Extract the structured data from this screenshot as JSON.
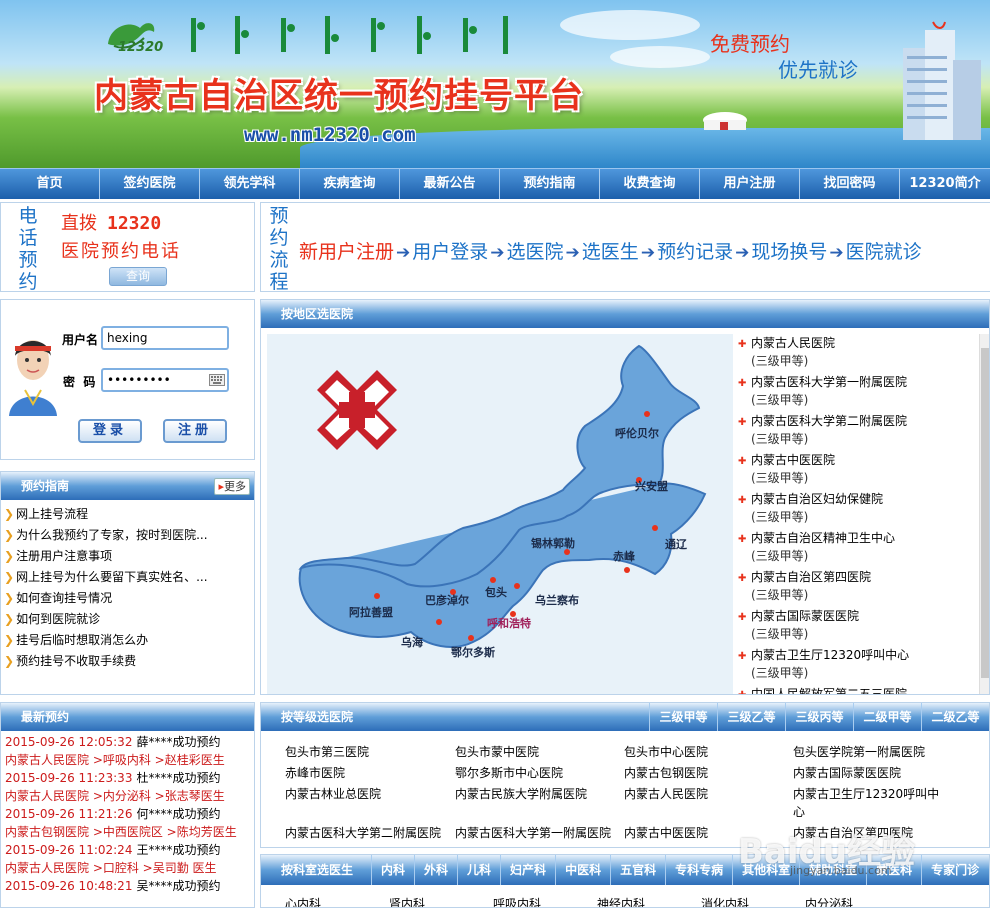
{
  "header": {
    "logo_text": "12320",
    "title": "内蒙古自治区统一预约挂号平台",
    "url": "www.nm12320.com",
    "slogan1": "免费预约",
    "slogan2": "优先就诊"
  },
  "nav": [
    "首页",
    "签约医院",
    "领先学科",
    "疾病查询",
    "最新公告",
    "预约指南",
    "收费查询",
    "用户注册",
    "找回密码",
    "12320简介"
  ],
  "phone": {
    "vertical": [
      "电",
      "话",
      "预",
      "约"
    ],
    "line1_prefix": "直拨",
    "line1_number": "12320",
    "line2": "医院预约电话",
    "query_button": "查询"
  },
  "flow": {
    "vertical": [
      "预",
      "约",
      "流",
      "程"
    ],
    "steps": [
      "新用户注册",
      "用户登录",
      "选医院",
      "选医生",
      "预约记录",
      "现场换号",
      "医院就诊"
    ],
    "arrow": "➔"
  },
  "login": {
    "username_label": "用户名",
    "username_value": "hexing",
    "password_label": "密  码",
    "password_value": "•••••••••",
    "login_button": "登录",
    "register_button": "注册"
  },
  "guide": {
    "title": "预约指南",
    "more": "更多",
    "items": [
      "网上挂号流程",
      "为什么我预约了专家，按时到医院...",
      "注册用户注意事项",
      "网上挂号为什么要留下真实姓名、...",
      "如何查询挂号情况",
      "如何到医院就诊",
      "挂号后临时想取消怎么办",
      "预约挂号不收取手续费"
    ]
  },
  "map": {
    "title": "按地区选医院",
    "regions": [
      "呼伦贝尔",
      "兴安盟",
      "通辽",
      "赤峰",
      "锡林郭勒",
      "乌兰察布",
      "呼和浩特",
      "包头",
      "巴彦淖尔",
      "阿拉善盟",
      "乌海",
      "鄂尔多斯"
    ],
    "hospitals": [
      {
        "name": "内蒙古人民医院",
        "level": "(三级甲等)"
      },
      {
        "name": "内蒙古医科大学第一附属医院",
        "level": "(三级甲等)"
      },
      {
        "name": "内蒙古医科大学第二附属医院",
        "level": "(三级甲等)"
      },
      {
        "name": "内蒙古中医医院",
        "level": "(三级甲等)"
      },
      {
        "name": "内蒙古自治区妇幼保健院",
        "level": "(三级甲等)"
      },
      {
        "name": "内蒙古自治区精神卫生中心",
        "level": "(三级甲等)"
      },
      {
        "name": "内蒙古自治区第四医院",
        "level": "(三级甲等)"
      },
      {
        "name": "内蒙古国际蒙医医院",
        "level": "(三级甲等)"
      },
      {
        "name": "内蒙古卫生厅12320呼叫中心",
        "level": "(三级甲等)"
      },
      {
        "name": "中国人民解放军第二五三医院",
        "level": ""
      }
    ]
  },
  "latest": {
    "title": "最新预约",
    "rows": [
      {
        "time": "2015-09-26 12:05:32",
        "text": "薛****成功预约",
        "dept": "内蒙古人民医院 >呼吸内科 >赵桂彩医生"
      },
      {
        "time": "2015-09-26 11:23:33",
        "text": "杜****成功预约",
        "dept": "内蒙古人民医院 >内分泌科 >张志琴医生"
      },
      {
        "time": "2015-09-26 11:21:26",
        "text": "何****成功预约",
        "dept": "内蒙古包钢医院 >中西医院区 >陈均芳医生"
      },
      {
        "time": "2015-09-26 11:02:24",
        "text": "王****成功预约",
        "dept": "内蒙古人民医院 >口腔科 >吴司勤 医生"
      },
      {
        "time": "2015-09-26 10:48:21",
        "text": "吴****成功预约",
        "dept": ""
      }
    ]
  },
  "level": {
    "title": "按等级选医院",
    "tabs": [
      "三级甲等",
      "三级乙等",
      "三级丙等",
      "二级甲等",
      "二级乙等"
    ],
    "cells": [
      [
        "包头市第三医院",
        "包头市蒙中医院",
        "包头市中心医院",
        "包头医学院第一附属医院"
      ],
      [
        "赤峰市医院",
        "鄂尔多斯市中心医院",
        "内蒙古包钢医院",
        "内蒙古国际蒙医医院"
      ],
      [
        "内蒙古林业总医院",
        "内蒙古民族大学附属医院",
        "内蒙古人民医院",
        "内蒙古卫生厅12320呼叫中心"
      ],
      [
        "内蒙古医科大学第二附属医院",
        "内蒙古医科大学第一附属医院",
        "内蒙古中医医院",
        "内蒙古自治区第四医院"
      ]
    ]
  },
  "dept": {
    "title": "按科室选医生",
    "tabs": [
      "内科",
      "外科",
      "儿科",
      "妇产科",
      "中医科",
      "五官科",
      "专科专病",
      "其他科室",
      "辅助科室",
      "蒙医科",
      "专家门诊"
    ],
    "items": [
      "心内科",
      "肾内科",
      "呼吸内科",
      "神经内科",
      "消化内科",
      "内分泌科"
    ]
  },
  "watermark": {
    "main": "Baidu经验",
    "sub": "jingyan.baidu.com"
  },
  "colors": {
    "accent_red": "#e8321c",
    "accent_blue": "#1e73c7",
    "nav_blue": "#2d6db8"
  }
}
